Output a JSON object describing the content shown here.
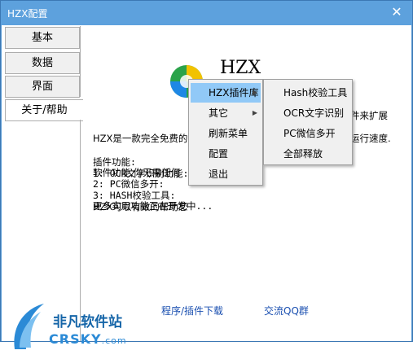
{
  "window": {
    "title": "HZX配置",
    "close_glyph": "✕"
  },
  "tabs": [
    {
      "label": "基本"
    },
    {
      "label": "数据"
    },
    {
      "label": "界面"
    },
    {
      "label": "关于/帮助"
    }
  ],
  "about": {
    "app_name": "HZX",
    "description_lines": [
      "HZX是一款完全免费的",
      "软件功能,你无需任何",
      "HZX可以有效的帮助您"
    ],
    "description_right": [
      "件来扩展",
      "运行速度."
    ],
    "features": "插件功能:\n1: OCR文字识别功能:\n2: PC微信多开:\n3: HASH校验工具:\n更多实用功能正在开发中...",
    "links": {
      "download": "程序/插件下载",
      "qq_group": "交流QQ群"
    }
  },
  "context_menu": {
    "items": [
      {
        "label": "HZX插件库",
        "has_submenu": true,
        "selected": true
      },
      {
        "label": "其它",
        "has_submenu": true,
        "selected": false
      },
      {
        "label": "刷新菜单",
        "has_submenu": false,
        "selected": false
      },
      {
        "label": "配置",
        "has_submenu": false,
        "selected": false
      },
      {
        "label": "退出",
        "has_submenu": false,
        "selected": false
      }
    ],
    "submenu": [
      {
        "label": "Hash校验工具"
      },
      {
        "label": "OCR文字识别"
      },
      {
        "label": "PC微信多开"
      },
      {
        "label": "全部释放"
      }
    ],
    "submenu_arrow": "▶"
  },
  "watermark": {
    "title": "非凡软件站",
    "sub": "CRSKY",
    "domain": ".com"
  },
  "colors": {
    "title_bar": "#5da1dd",
    "menu_highlight": "#91c9f7",
    "link": "#1a4fb0"
  }
}
